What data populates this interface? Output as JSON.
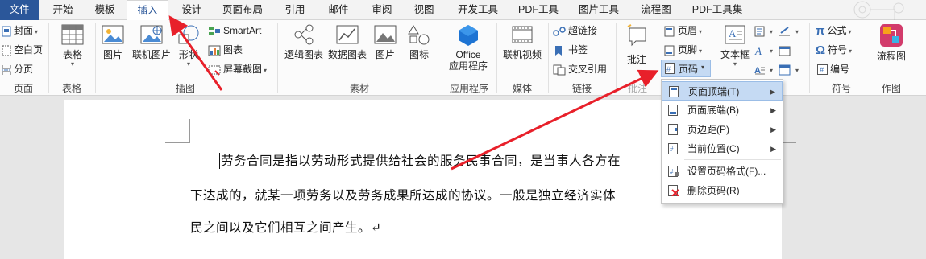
{
  "tabs": [
    "文件",
    "开始",
    "模板",
    "插入",
    "设计",
    "页面布局",
    "引用",
    "邮件",
    "审阅",
    "视图",
    "开发工具",
    "PDF工具",
    "图片工具",
    "流程图",
    "PDF工具集"
  ],
  "active_tab": "插入",
  "ribbon": {
    "pages": {
      "cover": "封面",
      "blank": "空白页",
      "break": "分页",
      "label": "页面"
    },
    "table": {
      "btn": "表格",
      "label": "表格"
    },
    "illustrations": {
      "picture": "图片",
      "online_picture": "联机图片",
      "shapes": "形状",
      "smartart": "SmartArt",
      "chart": "图表",
      "screenshot": "屏幕截图",
      "label": "插图"
    },
    "materials": {
      "logic_chart": "逻辑图表",
      "data_chart": "数据图表",
      "picture": "图片",
      "icon": "图标",
      "label": "素材"
    },
    "apps": {
      "office_line1": "Office",
      "office_line2": "应用程序",
      "label": "应用程序"
    },
    "media": {
      "online_video": "联机视频",
      "label": "媒体"
    },
    "links": {
      "hyperlink": "超链接",
      "bookmark": "书签",
      "cross_ref": "交叉引用",
      "label": "链接"
    },
    "comments": {
      "comment": "批注",
      "label": "批注"
    },
    "header_footer": {
      "header": "页眉",
      "footer": "页脚",
      "page_number": "页码"
    },
    "text": {
      "textbox": "文本框"
    },
    "symbols": {
      "formula": "公式",
      "symbol": "符号",
      "number": "编号",
      "label": "符号"
    },
    "flowchart": {
      "btn": "流程图",
      "label": "作图"
    }
  },
  "dropdown": {
    "items": [
      {
        "label": "页面顶端(T)",
        "has_submenu": true
      },
      {
        "label": "页面底端(B)",
        "has_submenu": true
      },
      {
        "label": "页边距(P)",
        "has_submenu": true
      },
      {
        "label": "当前位置(C)",
        "has_submenu": true
      },
      {
        "label": "设置页码格式(F)...",
        "has_submenu": false
      },
      {
        "label": "删除页码(R)",
        "has_submenu": false
      }
    ]
  },
  "document": {
    "lines": [
      "劳务合同是指以劳动形式提供给社会的服务民事合同，是当事人各方在",
      "下达成的，就某一项劳务以及劳务成果所达成的协议。一般是独立经济实体",
      "民之间以及它们相互之间产生。↵"
    ]
  },
  "colors": {
    "file_tab": "#2b579a",
    "highlight": "#c5daf3",
    "arrow": "#e8202a"
  }
}
